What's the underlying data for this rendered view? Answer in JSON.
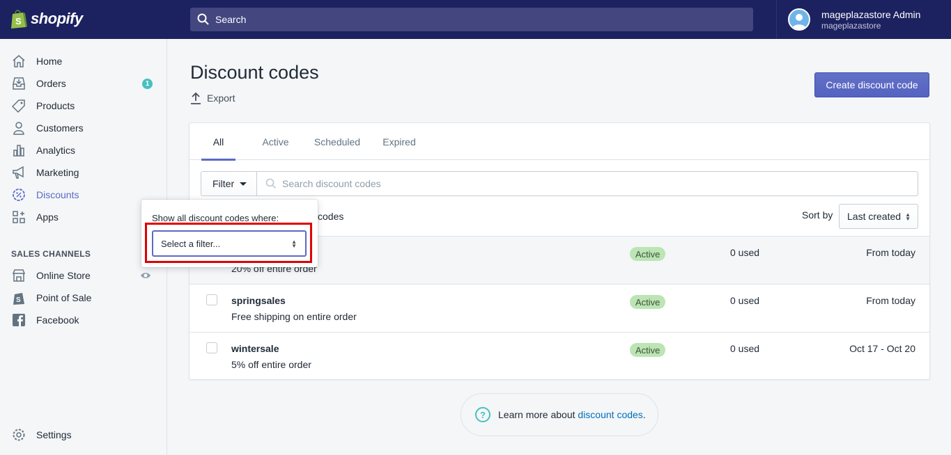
{
  "app": {
    "logo_text": "shopify"
  },
  "topbar": {
    "search_label": "Search",
    "user_name": "mageplazastore Admin",
    "user_store": "mageplazastore"
  },
  "sidebar": {
    "items": [
      {
        "label": "Home",
        "icon": "home-icon"
      },
      {
        "label": "Orders",
        "icon": "orders-icon",
        "badge": "1"
      },
      {
        "label": "Products",
        "icon": "tag-icon"
      },
      {
        "label": "Customers",
        "icon": "person-icon"
      },
      {
        "label": "Analytics",
        "icon": "bar-chart-icon"
      },
      {
        "label": "Marketing",
        "icon": "megaphone-icon"
      },
      {
        "label": "Discounts",
        "icon": "discount-icon",
        "active": true
      },
      {
        "label": "Apps",
        "icon": "apps-icon"
      }
    ],
    "sales_channels_title": "SALES CHANNELS",
    "channels": [
      {
        "label": "Online Store",
        "icon": "store-icon"
      },
      {
        "label": "Point of Sale",
        "icon": "pos-icon"
      },
      {
        "label": "Facebook",
        "icon": "facebook-icon"
      }
    ],
    "settings_label": "Settings"
  },
  "main": {
    "title": "Discount codes",
    "export_label": "Export",
    "create_button": "Create discount code",
    "tabs": [
      "All",
      "Active",
      "Scheduled",
      "Expired"
    ],
    "filter_label": "Filter",
    "search_placeholder": "Search discount codes",
    "showing_text": "codes",
    "sort_label": "Sort by",
    "sort_value": "Last created",
    "rows": [
      {
        "code": "",
        "description": "20% off entire order",
        "status": "Active",
        "used": "0 used",
        "dates": "From today"
      },
      {
        "code": "springsales",
        "description": "Free shipping on entire order",
        "status": "Active",
        "used": "0 used",
        "dates": "From today"
      },
      {
        "code": "wintersale",
        "description": "5% off entire order",
        "status": "Active",
        "used": "0 used",
        "dates": "Oct 17 - Oct 20"
      }
    ]
  },
  "popover": {
    "title": "Show all discount codes where:",
    "select_placeholder": "Select a filter..."
  },
  "learn_more": {
    "prefix": "Learn more about ",
    "link": "discount codes",
    "suffix": "."
  },
  "colors": {
    "topbar": "#1c2260",
    "accent": "#5c6ac4",
    "status_active": "#bbe5b3",
    "highlight_box": "#e00000"
  }
}
